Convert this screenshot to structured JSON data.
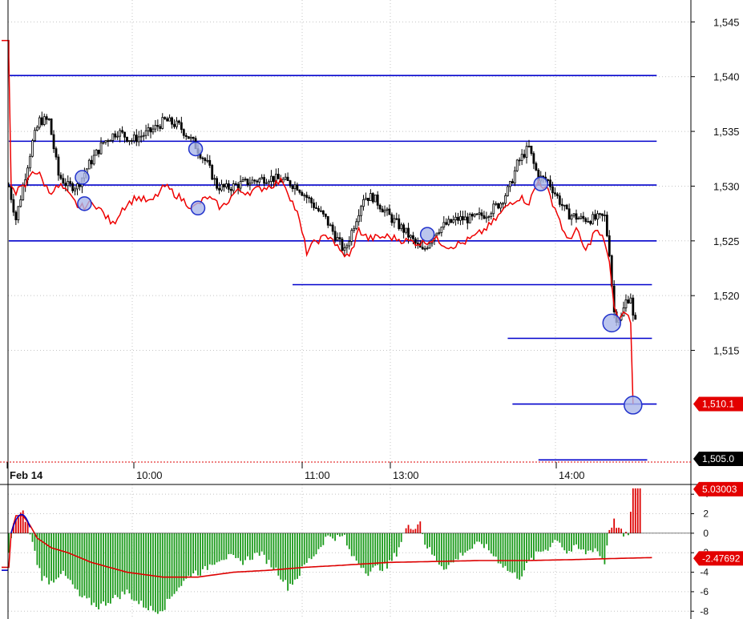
{
  "chart_data": [
    {
      "type": "candlestick",
      "panel": "price",
      "x_labels": [
        "Feb 14",
        "10:00",
        "11:00",
        "13:00",
        "14:00"
      ],
      "y_ticks": [
        "1,545",
        "1,540",
        "1,535",
        "1,530",
        "1,525",
        "1,520",
        "1,515"
      ],
      "ylim": [
        1504.8,
        1547
      ],
      "horizontal_levels": [
        {
          "price": 1540.1,
          "from_bar": 0,
          "to_bar": 274
        },
        {
          "price": 1534.1,
          "from_bar": 0,
          "to_bar": 274
        },
        {
          "price": 1530.1,
          "from_bar": 0,
          "to_bar": 274
        },
        {
          "price": 1525.0,
          "from_bar": 0,
          "to_bar": 274
        },
        {
          "price": 1521.0,
          "from_bar": 120,
          "to_bar": 272
        },
        {
          "price": 1516.1,
          "from_bar": 211,
          "to_bar": 272
        },
        {
          "price": 1510.1,
          "from_bar": 213,
          "to_bar": 274
        },
        {
          "price": 1505.0,
          "from_bar": 224,
          "to_bar": 270
        }
      ],
      "markers": [
        {
          "bar": 31,
          "price": 1530.8
        },
        {
          "bar": 32,
          "price": 1528.4
        },
        {
          "bar": 79,
          "price": 1533.4
        },
        {
          "bar": 80,
          "price": 1528.0
        },
        {
          "bar": 177,
          "price": 1525.6
        },
        {
          "bar": 225,
          "price": 1530.2
        },
        {
          "bar": 255,
          "price": 1517.5
        },
        {
          "bar": 264,
          "price": 1510.0
        }
      ],
      "last_price_tags": [
        {
          "label": "1,510.1",
          "price": 1510.1,
          "style": "red"
        },
        {
          "label": "1,505.0",
          "price": 1505.0,
          "style": "black"
        }
      ]
    },
    {
      "type": "bar",
      "panel": "oscillator",
      "y_ticks": [
        "4",
        "2",
        "0",
        "-2",
        "-4",
        "-6",
        "-8"
      ],
      "ylim": [
        -8.8,
        5.0
      ],
      "value_tags": [
        {
          "label": "5.03003",
          "value": 4.6,
          "style": "red"
        },
        {
          "label": "-2.47692",
          "value": -2.5,
          "style": "red"
        }
      ]
    }
  ],
  "colors": {
    "candle": "#000000",
    "level_line": "#0000cc",
    "overlay_line": "#ee0000",
    "marker_fill": "#aab6e8",
    "marker_stroke": "#2233cc",
    "hist_up": "#dd0000",
    "hist_down": "#1a9a1a",
    "signal_line": "#dd0000",
    "grid": "#c4c4c4",
    "hist_signal_early": "#8b4513"
  }
}
